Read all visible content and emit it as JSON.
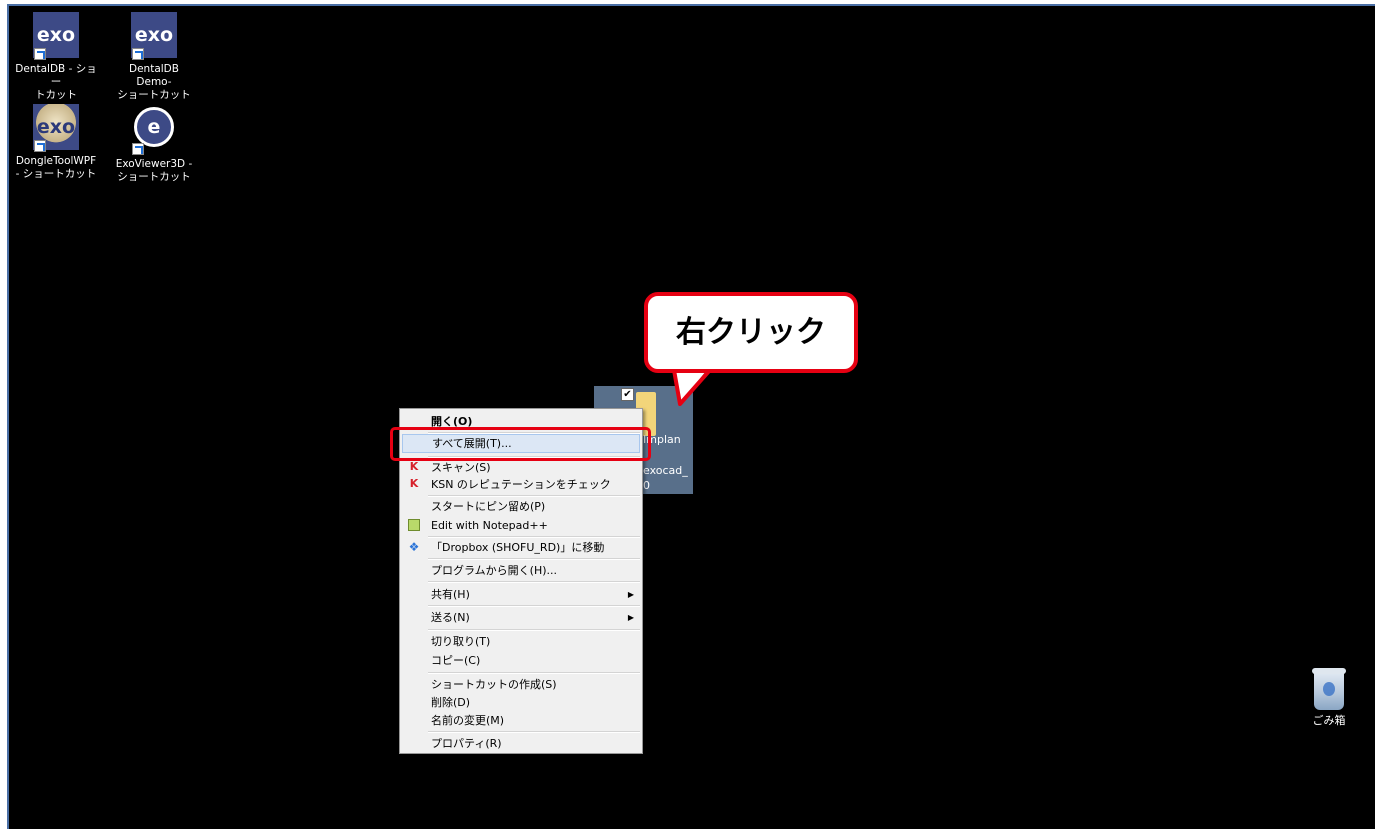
{
  "desktop_icons": [
    {
      "name": "DentalDB - ショートカット",
      "line1": "DentalDB - ショー",
      "line2": "トカット",
      "tile": "exo"
    },
    {
      "name": "DentalDB Demo - ショートカット",
      "line1": "DentalDB Demo-",
      "line2": "ショートカット",
      "tile": "exo"
    },
    {
      "name": "DongleToolWPF - ショートカット",
      "line1": "DongleToolWPF",
      "line2": "- ショートカット",
      "tile": "exo"
    },
    {
      "name": "ExoViewer3D - ショートカット",
      "line1": "ExoViewer3D -",
      "line2": "ショートカット",
      "tile": "e"
    }
  ],
  "selected_item": {
    "line1": "Implan",
    "line2": "exocad_",
    "line3": "0",
    "checked": true
  },
  "context_menu": {
    "open": "開く(O)",
    "extract_all": "すべて展開(T)...",
    "scan": "スキャン(S)",
    "ksn_check": "KSN のレピュテーションをチェック",
    "pin_to_start": "スタートにピン留め(P)",
    "edit_notepad": "Edit with Notepad++",
    "move_dropbox": "「Dropbox (SHOFU_RD)」に移動",
    "open_with": "プログラムから開く(H)...",
    "share": "共有(H)",
    "send_to": "送る(N)",
    "cut": "切り取り(T)",
    "copy": "コピー(C)",
    "create_shortcut": "ショートカットの作成(S)",
    "delete": "削除(D)",
    "rename": "名前の変更(M)",
    "properties": "プロパティ(R)"
  },
  "callout_text": "右クリック",
  "recycle_bin_label": "ごみ箱",
  "colors": {
    "desktop": "#000000",
    "highlight": "#e60012",
    "menu_bg": "#f0f0f0",
    "menu_hover": "#dce7f5"
  }
}
